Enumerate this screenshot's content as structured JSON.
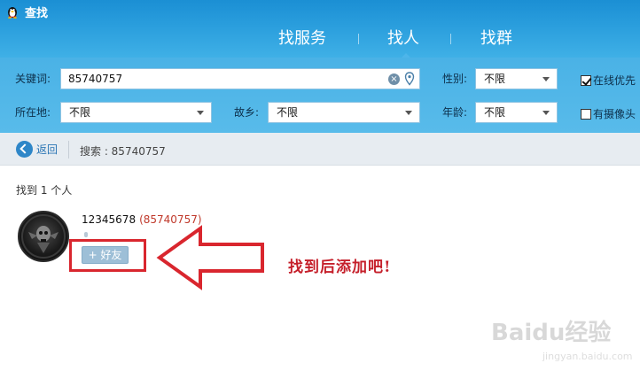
{
  "window": {
    "title": "查找"
  },
  "nav": {
    "tabs": [
      {
        "label": "找服务",
        "active": false
      },
      {
        "label": "找人",
        "active": true
      },
      {
        "label": "找群",
        "active": false
      }
    ]
  },
  "filters": {
    "keyword_label": "关键词:",
    "keyword_value": "85740757",
    "gender_label": "性别:",
    "gender_value": "不限",
    "online_first_label": "在线优先",
    "online_first_checked": true,
    "location_label": "所在地:",
    "location_value": "不限",
    "hometown_label": "故乡:",
    "hometown_value": "不限",
    "age_label": "年龄:",
    "age_value": "不限",
    "has_camera_label": "有摄像头",
    "has_camera_checked": false
  },
  "breadcrumb": {
    "back_label": "返回",
    "search_text": "搜索 : 85740757"
  },
  "results": {
    "count_text": "找到 1 个人",
    "items": [
      {
        "nickname": "12345678",
        "qq_display": "(85740757)",
        "add_label": "+ 好友"
      }
    ]
  },
  "annotation": {
    "text": "找到后添加吧!"
  },
  "watermark": {
    "text": "Baidu经验",
    "sub": "jingyan.baidu.com"
  },
  "colors": {
    "header_blue": "#1b8fd4",
    "filter_blue": "#4ab2e6",
    "annotation_red": "#d9262e",
    "uid_red": "#c0392b"
  }
}
